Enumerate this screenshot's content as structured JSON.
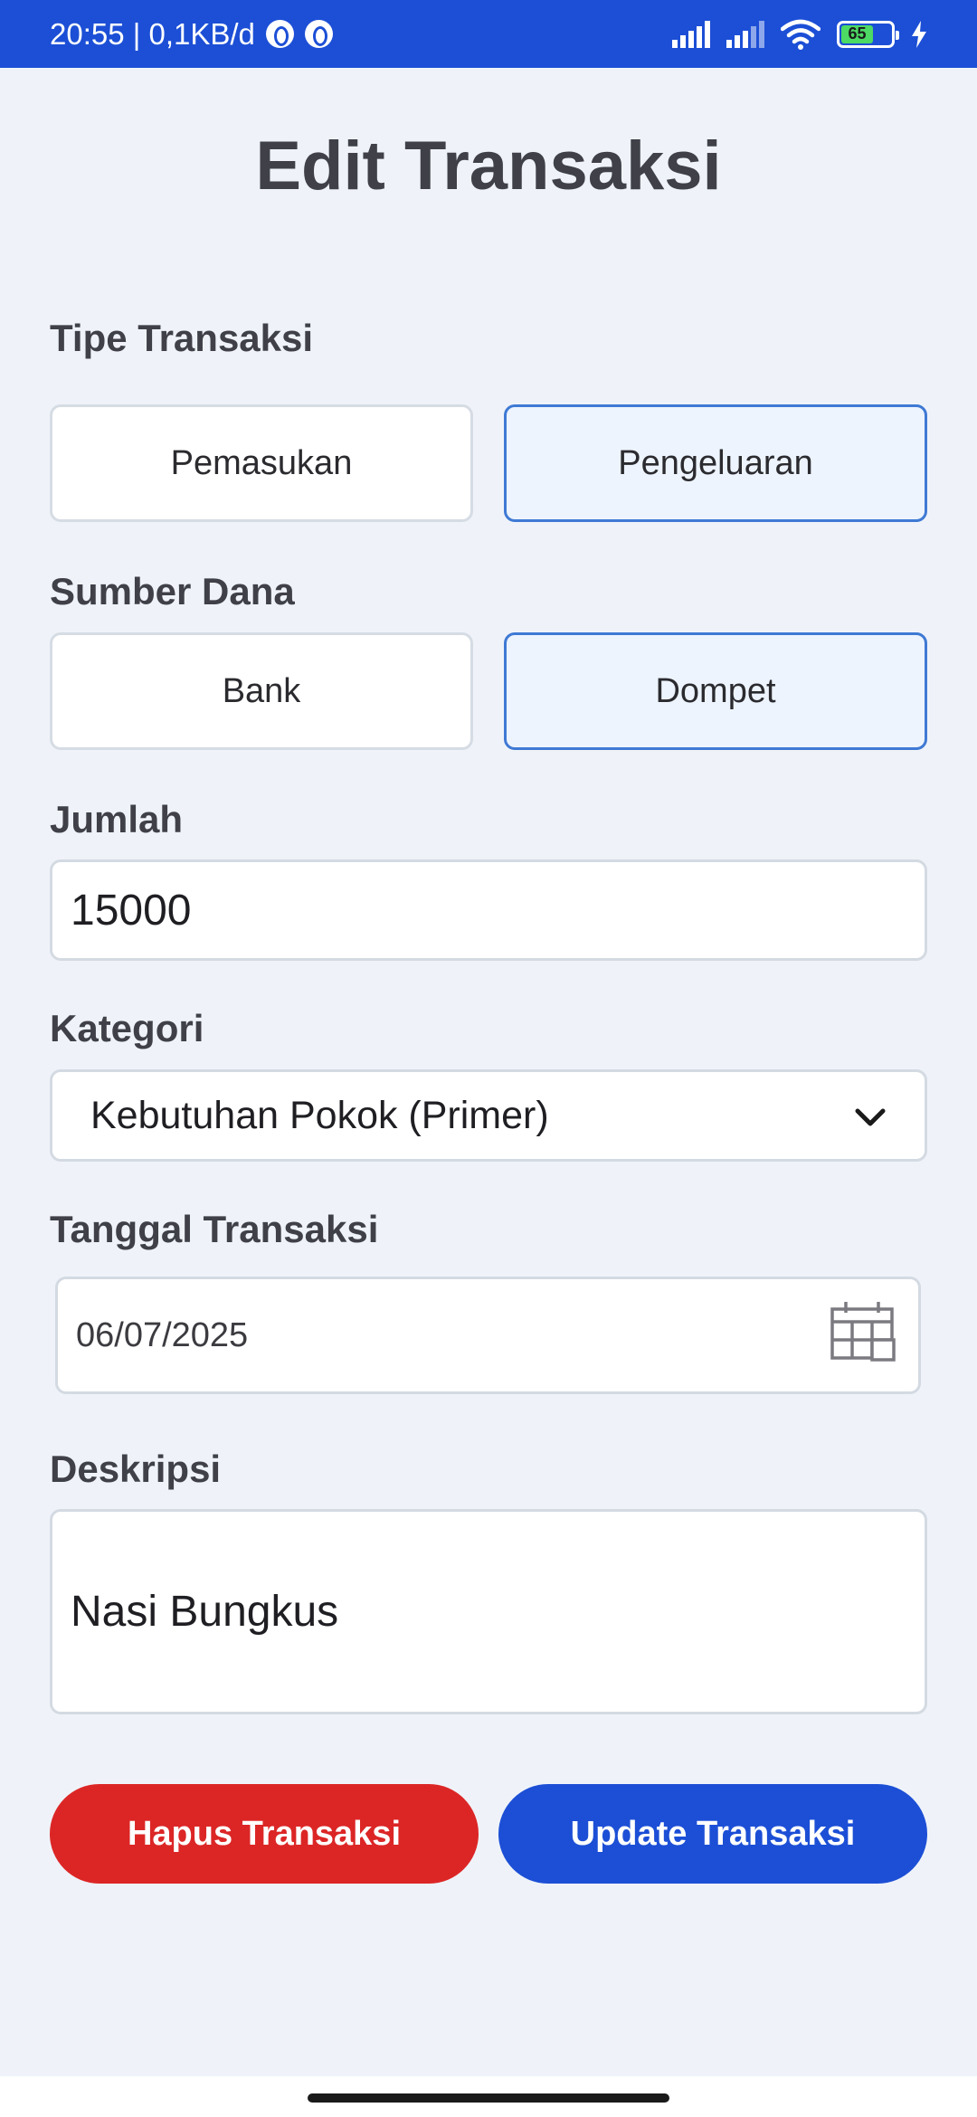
{
  "status_bar": {
    "time_info": "20:55 | 0,1KB/d",
    "battery_level": "65",
    "battery_percent": 65
  },
  "page": {
    "title": "Edit Transaksi"
  },
  "transaction_type": {
    "label": "Tipe Transaksi",
    "options": [
      "Pemasukan",
      "Pengeluaran"
    ],
    "selected": "Pengeluaran"
  },
  "fund_source": {
    "label": "Sumber Dana",
    "options": [
      "Bank",
      "Dompet"
    ],
    "selected": "Dompet"
  },
  "amount": {
    "label": "Jumlah",
    "value": "15000"
  },
  "category": {
    "label": "Kategori",
    "value": "Kebutuhan Pokok (Primer)"
  },
  "date": {
    "label": "Tanggal Transaksi",
    "value": "06/07/2025"
  },
  "description": {
    "label": "Deskripsi",
    "value": "Nasi Bungkus"
  },
  "actions": {
    "delete_label": "Hapus Transaksi",
    "update_label": "Update Transaksi"
  },
  "colors": {
    "primary": "#1c4fd6",
    "danger": "#dc2626",
    "selected_bg": "#edf4fe",
    "selected_border": "#3f79d4",
    "background": "#eff3f9"
  },
  "icons": [
    "notification-app-icon",
    "signal-icon",
    "wifi-icon",
    "battery-icon",
    "charging-icon",
    "chevron-down-icon",
    "calendar-icon"
  ]
}
